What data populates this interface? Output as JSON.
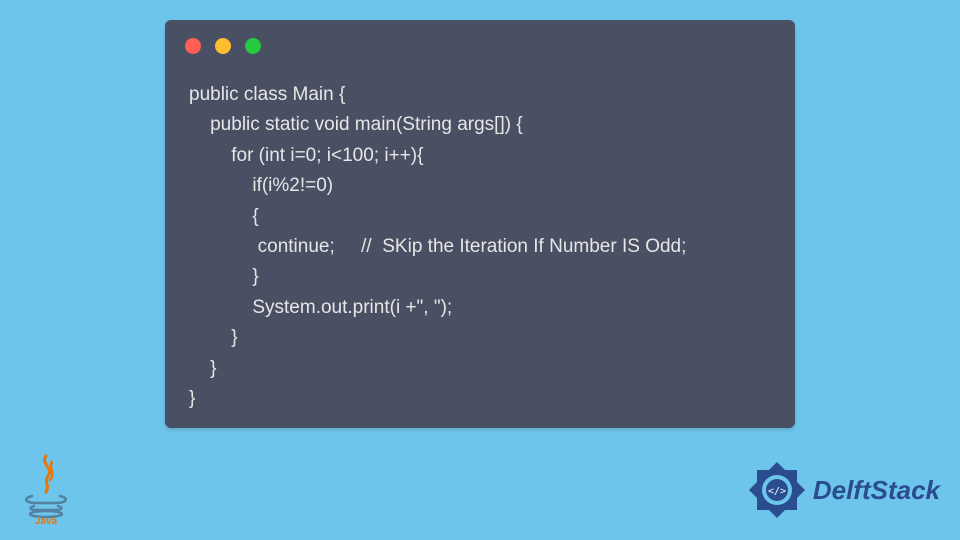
{
  "code_window": {
    "lines": [
      "public class Main {",
      "    public static void main(String args[]) {",
      "        for (int i=0; i<100; i++){",
      "            if(i%2!=0)",
      "            {",
      "             continue;     //  SKip the Iteration If Number IS Odd;",
      "            }",
      "            System.out.print(i +\", \");",
      "        }",
      "    }",
      "}"
    ]
  },
  "java_logo": {
    "label": "Java"
  },
  "brand": {
    "name": "DelftStack"
  },
  "colors": {
    "page_bg": "#6ec5eb",
    "window_bg": "#4a5064",
    "code_fg": "#e6e6e6",
    "brand_accent": "#2a4d8f"
  }
}
